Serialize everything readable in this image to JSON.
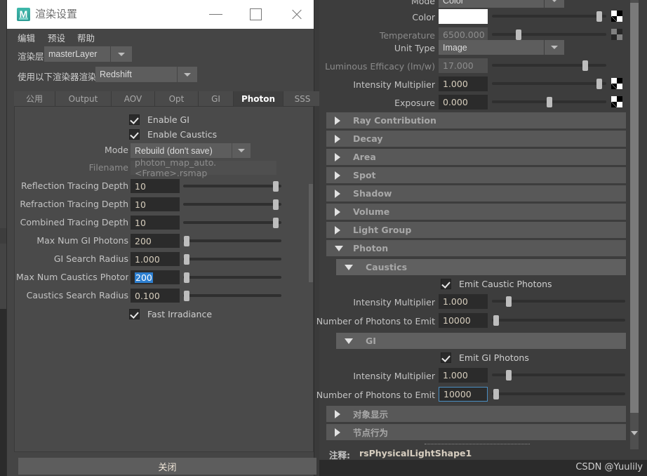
{
  "window": {
    "title": "渲染设置",
    "icon": "maya-icon",
    "minimize": "—",
    "maximize": "□",
    "close": "✕"
  },
  "menubar": {
    "items": [
      "编辑",
      "预设",
      "帮助"
    ]
  },
  "render_layer": {
    "label": "渲染层",
    "value": "masterLayer"
  },
  "renderer": {
    "label": "使用以下渲染器渲染",
    "value": "Redshift"
  },
  "tabs": {
    "items": [
      "公用",
      "Output",
      "AOV",
      "Opt",
      "GI",
      "Photon",
      "SSS"
    ],
    "active": "Photon"
  },
  "photon_tab": {
    "enable_gi": {
      "label": "Enable GI",
      "checked": true
    },
    "enable_caustics": {
      "label": "Enable Caustics",
      "checked": true
    },
    "mode": {
      "label": "Mode",
      "value": "Rebuild (don't save)"
    },
    "filename": {
      "label": "Filename",
      "value": "photon_map_auto.<Frame>.rsmap",
      "disabled": true
    },
    "sliders": [
      {
        "label": "Reflection Tracing Depth",
        "value": "10",
        "knob_pct": 97
      },
      {
        "label": "Refraction Tracing Depth",
        "value": "10",
        "knob_pct": 97
      },
      {
        "label": "Combined Tracing Depth",
        "value": "10",
        "knob_pct": 97
      },
      {
        "label": "Max Num GI Photons",
        "value": "200",
        "knob_pct": 1
      },
      {
        "label": "GI Search Radius",
        "value": "1.000",
        "knob_pct": 1
      },
      {
        "label": "Max Num Caustics Photons",
        "value": "200",
        "knob_pct": 1,
        "selected": true
      },
      {
        "label": "Caustics Search Radius",
        "value": "0.100",
        "knob_pct": 1
      }
    ],
    "fast_irradiance": {
      "label": "Fast Irradiance",
      "checked": true
    }
  },
  "close_button": {
    "label": "关闭"
  },
  "attribute_editor": {
    "top_rows": [
      {
        "label": "Mode",
        "type": "combo",
        "value": "Color",
        "clipped": true
      },
      {
        "label": "Color",
        "type": "swatch",
        "value": "#ffffff",
        "knob_pct": 96,
        "has_map": true
      },
      {
        "label": "Temperature",
        "type": "field",
        "value": "6500.000",
        "disabled": true,
        "knob_pct": 22,
        "has_map": true,
        "map_dim": true
      },
      {
        "label": "Unit Type",
        "type": "combo",
        "value": "Image"
      },
      {
        "label": "Luminous Efficacy (lm/w)",
        "type": "field",
        "value": "17.000",
        "disabled": true,
        "knob_pct": 83
      },
      {
        "label": "Intensity Multiplier",
        "type": "field",
        "value": "1.000",
        "knob_pct": 96,
        "has_map": true
      },
      {
        "label": "Exposure",
        "type": "field",
        "value": "0.000",
        "knob_pct": 50,
        "has_map": true
      }
    ],
    "sections": [
      {
        "title": "Ray Contribution",
        "expanded": false
      },
      {
        "title": "Decay",
        "expanded": false
      },
      {
        "title": "Area",
        "expanded": false
      },
      {
        "title": "Spot",
        "expanded": false
      },
      {
        "title": "Shadow",
        "expanded": false
      },
      {
        "title": "Volume",
        "expanded": false
      },
      {
        "title": "Light Group",
        "expanded": false
      },
      {
        "title": "Photon",
        "expanded": true
      }
    ],
    "caustics": {
      "title": "Caustics",
      "emit": {
        "label": "Emit Caustic Photons",
        "checked": true
      },
      "intensity": {
        "label": "Intensity Multiplier",
        "value": "1.000",
        "knob_pct": 11
      },
      "photons": {
        "label": "Number of Photons to Emit",
        "value": "10000",
        "knob_pct": 1
      }
    },
    "gi": {
      "title": "GI",
      "emit": {
        "label": "Emit GI Photons",
        "checked": true
      },
      "intensity": {
        "label": "Intensity Multiplier",
        "value": "1.000",
        "knob_pct": 11
      },
      "photons": {
        "label": "Number of Photons to Emit",
        "value": "10000",
        "knob_pct": 1,
        "focused": true
      }
    },
    "bottom_sections": [
      {
        "title": "对象显示",
        "expanded": false
      },
      {
        "title": "节点行为",
        "expanded": false
      }
    ],
    "note": {
      "label": "注释:",
      "value": "rsPhysicalLightShape1"
    }
  },
  "watermark": {
    "text": "CSDN @Yuulily"
  }
}
